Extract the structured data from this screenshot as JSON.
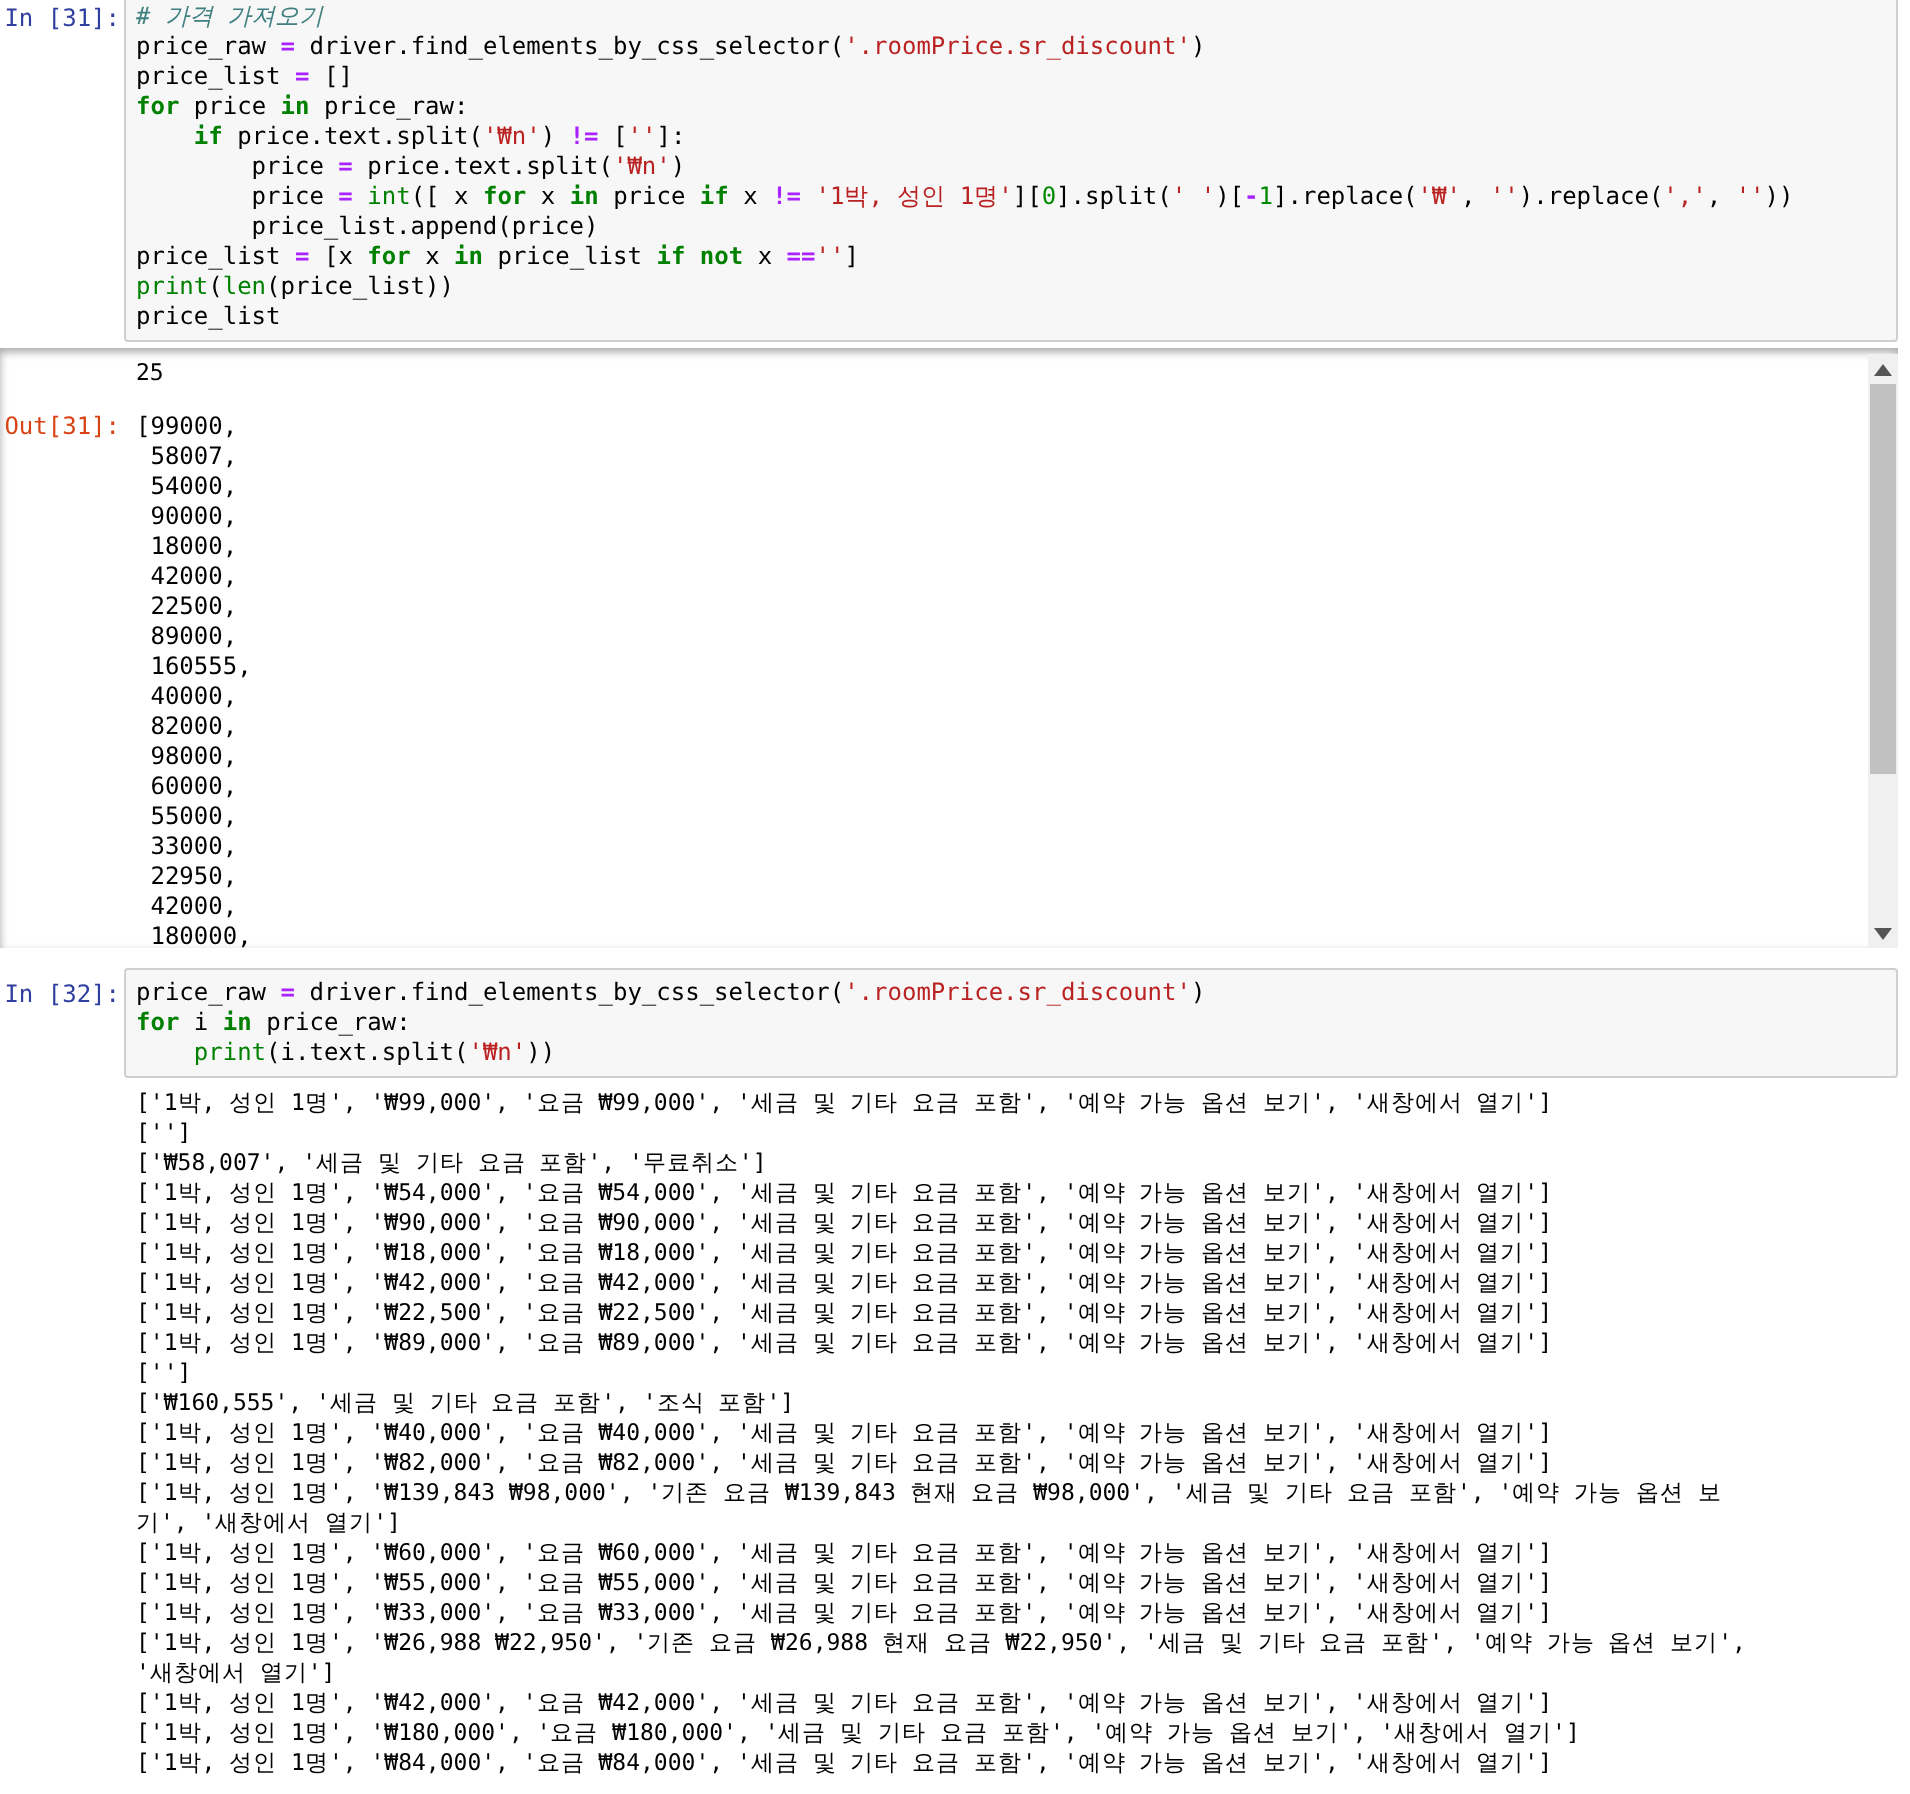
{
  "cells": [
    {
      "prompt": "In [31]:",
      "code": [
        [
          "# 가격 가져오기"
        ],
        [
          "price_raw = driver.find_elements_by_css_selector('.roomPrice.sr_discount')"
        ],
        [
          "price_list = []"
        ],
        [
          "for price in price_raw:"
        ],
        [
          "    if price.text.split('₩n') != ['']:"
        ],
        [
          "        price = price.text.split('₩n')"
        ],
        [
          "        price = int([ x for x in price if x != '1박, 성인 1명'][0].split(' ')[-1].replace('₩', '').replace(',', ''))"
        ],
        [
          "        price_list.append(price)"
        ],
        [
          "price_list = [x for x in price_list if not x =='']"
        ],
        [
          "print(len(price_list))"
        ],
        [
          "price_list"
        ]
      ],
      "outputs": [
        {
          "kind": "stream",
          "lines": [
            "25"
          ]
        },
        {
          "kind": "result",
          "prompt": "Out[31]:",
          "lines": [
            "[99000,",
            " 58007,",
            " 54000,",
            " 90000,",
            " 18000,",
            " 42000,",
            " 22500,",
            " 89000,",
            " 160555,",
            " 40000,",
            " 82000,",
            " 98000,",
            " 60000,",
            " 55000,",
            " 33000,",
            " 22950,",
            " 42000,",
            " 180000,"
          ]
        }
      ],
      "scrolled": true
    },
    {
      "prompt": "In [32]:",
      "code": [
        [
          "price_raw = driver.find_elements_by_css_selector('.roomPrice.sr_discount')"
        ],
        [
          "for i in price_raw:"
        ],
        [
          "    print(i.text.split('₩n'))"
        ]
      ],
      "outputs": [
        {
          "kind": "stream",
          "lines": [
            "['1박, 성인 1명', '₩99,000', '요금 ₩99,000', '세금 및 기타 요금 포함', '예약 가능 옵션 보기', '새창에서 열기']",
            "['']",
            "['₩58,007', '세금 및 기타 요금 포함', '무료취소']",
            "['1박, 성인 1명', '₩54,000', '요금 ₩54,000', '세금 및 기타 요금 포함', '예약 가능 옵션 보기', '새창에서 열기']",
            "['1박, 성인 1명', '₩90,000', '요금 ₩90,000', '세금 및 기타 요금 포함', '예약 가능 옵션 보기', '새창에서 열기']",
            "['1박, 성인 1명', '₩18,000', '요금 ₩18,000', '세금 및 기타 요금 포함', '예약 가능 옵션 보기', '새창에서 열기']",
            "['1박, 성인 1명', '₩42,000', '요금 ₩42,000', '세금 및 기타 요금 포함', '예약 가능 옵션 보기', '새창에서 열기']",
            "['1박, 성인 1명', '₩22,500', '요금 ₩22,500', '세금 및 기타 요금 포함', '예약 가능 옵션 보기', '새창에서 열기']",
            "['1박, 성인 1명', '₩89,000', '요금 ₩89,000', '세금 및 기타 요금 포함', '예약 가능 옵션 보기', '새창에서 열기']",
            "['']",
            "['₩160,555', '세금 및 기타 요금 포함', '조식 포함']",
            "['1박, 성인 1명', '₩40,000', '요금 ₩40,000', '세금 및 기타 요금 포함', '예약 가능 옵션 보기', '새창에서 열기']",
            "['1박, 성인 1명', '₩82,000', '요금 ₩82,000', '세금 및 기타 요금 포함', '예약 가능 옵션 보기', '새창에서 열기']",
            "['1박, 성인 1명', '₩139,843 ₩98,000', '기존 요금 ₩139,843 현재 요금 ₩98,000', '세금 및 기타 요금 포함', '예약 가능 옵션 보",
            "기', '새창에서 열기']",
            "['1박, 성인 1명', '₩60,000', '요금 ₩60,000', '세금 및 기타 요금 포함', '예약 가능 옵션 보기', '새창에서 열기']",
            "['1박, 성인 1명', '₩55,000', '요금 ₩55,000', '세금 및 기타 요금 포함', '예약 가능 옵션 보기', '새창에서 열기']",
            "['1박, 성인 1명', '₩33,000', '요금 ₩33,000', '세금 및 기타 요금 포함', '예약 가능 옵션 보기', '새창에서 열기']",
            "['1박, 성인 1명', '₩26,988 ₩22,950', '기존 요금 ₩26,988 현재 요금 ₩22,950', '세금 및 기타 요금 포함', '예약 가능 옵션 보기',",
            "'새창에서 열기']",
            "['1박, 성인 1명', '₩42,000', '요금 ₩42,000', '세금 및 기타 요금 포함', '예약 가능 옵션 보기', '새창에서 열기']",
            "['1박, 성인 1명', '₩180,000', '요금 ₩180,000', '세금 및 기타 요금 포함', '예약 가능 옵션 보기', '새창에서 열기']",
            "['1박, 성인 1명', '₩84,000', '요금 ₩84,000', '세금 및 기타 요금 포함', '예약 가능 옵션 보기', '새창에서 열기']"
          ]
        }
      ],
      "scrolled": false
    }
  ]
}
